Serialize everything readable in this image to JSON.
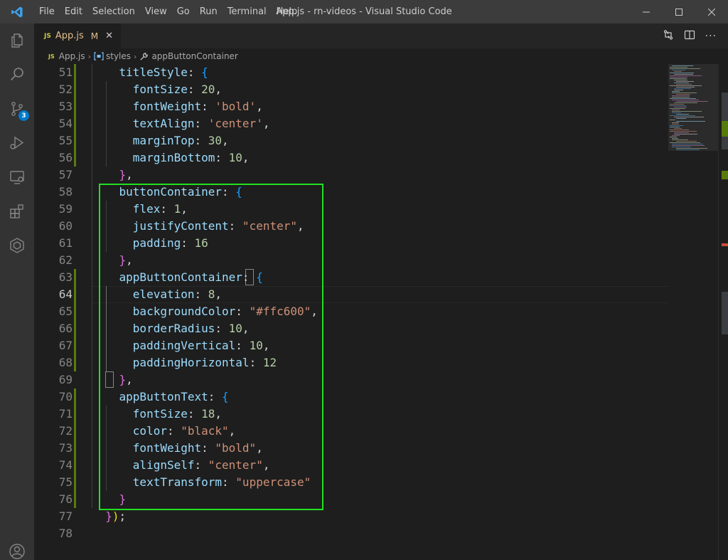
{
  "titlebar": {
    "menu": [
      "File",
      "Edit",
      "Selection",
      "View",
      "Go",
      "Run",
      "Terminal",
      "Help"
    ],
    "window_title": "App.js - rn-videos - Visual Studio Code",
    "logo_icon": "vscode-logo-icon"
  },
  "activity_bar": {
    "items": [
      "explorer-icon",
      "search-icon",
      "source-control-icon",
      "run-debug-icon",
      "remote-explorer-icon",
      "extensions-icon",
      "docker-icon",
      "account-icon"
    ],
    "source_control_badge": "3"
  },
  "tabs": [
    {
      "label": "App.js",
      "badge": "JS",
      "modified": "M",
      "close": "✕"
    }
  ],
  "breadcrumb": {
    "file": "App.js",
    "symbol1": "styles",
    "symbol2": "appButtonContainer"
  },
  "editor": {
    "active_line": "64",
    "lines": [
      {
        "num": "51",
        "indent": "    ",
        "text": "titleStyle: {"
      },
      {
        "num": "52",
        "indent": "      ",
        "text": "fontSize: 20,"
      },
      {
        "num": "53",
        "indent": "      ",
        "text": "fontWeight: 'bold',"
      },
      {
        "num": "54",
        "indent": "      ",
        "text": "textAlign: 'center',"
      },
      {
        "num": "55",
        "indent": "      ",
        "text": "marginTop: 30,"
      },
      {
        "num": "56",
        "indent": "      ",
        "text": "marginBottom: 10,"
      },
      {
        "num": "57",
        "indent": "    ",
        "text": "},"
      },
      {
        "num": "58",
        "indent": "    ",
        "text": "buttonContainer: {"
      },
      {
        "num": "59",
        "indent": "      ",
        "text": "flex: 1,"
      },
      {
        "num": "60",
        "indent": "      ",
        "text": "justifyContent: \"center\","
      },
      {
        "num": "61",
        "indent": "      ",
        "text": "padding: 16"
      },
      {
        "num": "62",
        "indent": "    ",
        "text": "},"
      },
      {
        "num": "63",
        "indent": "    ",
        "text": "appButtonContainer: {"
      },
      {
        "num": "64",
        "indent": "      ",
        "text": "elevation: 8,"
      },
      {
        "num": "65",
        "indent": "      ",
        "text": "backgroundColor: \"#ffc600\","
      },
      {
        "num": "66",
        "indent": "      ",
        "text": "borderRadius: 10,"
      },
      {
        "num": "67",
        "indent": "      ",
        "text": "paddingVertical: 10,"
      },
      {
        "num": "68",
        "indent": "      ",
        "text": "paddingHorizontal: 12"
      },
      {
        "num": "69",
        "indent": "    ",
        "text": "},"
      },
      {
        "num": "70",
        "indent": "    ",
        "text": "appButtonText: {"
      },
      {
        "num": "71",
        "indent": "      ",
        "text": "fontSize: 18,"
      },
      {
        "num": "72",
        "indent": "      ",
        "text": "color: \"black\","
      },
      {
        "num": "73",
        "indent": "      ",
        "text": "fontWeight: \"bold\","
      },
      {
        "num": "74",
        "indent": "      ",
        "text": "alignSelf: \"center\","
      },
      {
        "num": "75",
        "indent": "      ",
        "text": "textTransform: \"uppercase\""
      },
      {
        "num": "76",
        "indent": "    ",
        "text": "}"
      },
      {
        "num": "77",
        "indent": "  ",
        "text": "});"
      },
      {
        "num": "78",
        "indent": "",
        "text": ""
      }
    ]
  },
  "colors": {
    "highlight_box": "#22e022",
    "git_modified": "#587c0c",
    "accent": "#007acc"
  }
}
